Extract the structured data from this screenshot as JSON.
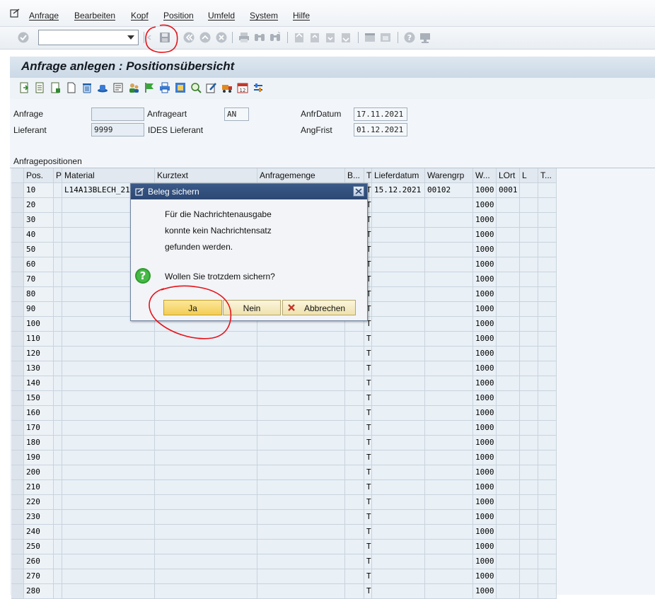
{
  "menu": [
    "Anfrage",
    "Bearbeiten",
    "Kopf",
    "Position",
    "Umfeld",
    "System",
    "Hilfe"
  ],
  "title": "Anfrage anlegen : Positionsübersicht",
  "header": {
    "anfrage_label": "Anfrage",
    "anfrage_value": "",
    "anfrageart_label": "Anfrageart",
    "anfrageart_value": "AN",
    "anfrdatum_label": "AnfrDatum",
    "anfrdatum_value": "17.11.2021",
    "lieferant_label": "Lieferant",
    "lieferant_value": "9999",
    "lieferant_name": "IDES Lieferant",
    "angfrist_label": "AngFrist",
    "angfrist_value": "01.12.2021"
  },
  "section_label": "Anfragepositionen",
  "table": {
    "columns": [
      "Pos.",
      "P",
      "Material",
      "Kurztext",
      "Anfragemenge",
      "B...",
      "T",
      "Lieferdatum",
      "Warengrp",
      "W...",
      "LOrt",
      "L",
      "T..."
    ],
    "first_row": {
      "pos": "10",
      "material": "L14A13BLECH_21",
      "t": "T",
      "lieferdatum": "15.12.2021",
      "warengrp": "00102",
      "w": "1000",
      "lort": "0001"
    },
    "positions": [
      "20",
      "30",
      "40",
      "50",
      "60",
      "70",
      "80",
      "90",
      "100",
      "110",
      "120",
      "130",
      "140",
      "150",
      "160",
      "170",
      "180",
      "190",
      "200",
      "210",
      "220",
      "230",
      "240",
      "250",
      "260",
      "270",
      "280"
    ],
    "t_value": "T",
    "w_value": "1000"
  },
  "dialog": {
    "title": "Beleg sichern",
    "line1": "Für die Nachrichtenausgabe",
    "line2": "konnte kein Nachrichtensatz",
    "line3": "gefunden werden.",
    "question": "Wollen Sie trotzdem sichern?",
    "btn_yes": "Ja",
    "btn_no": "Nein",
    "btn_cancel": "Abbrechen"
  },
  "colors": {
    "annotation": "#e8121a",
    "title_bar": "#2c4773",
    "button_yes": "#f3cd54"
  },
  "icons": [
    "enter-icon",
    "save-icon",
    "back-icon",
    "exit-icon",
    "cancel-icon",
    "print-icon",
    "find-icon",
    "help-icon",
    "question-icon"
  ]
}
